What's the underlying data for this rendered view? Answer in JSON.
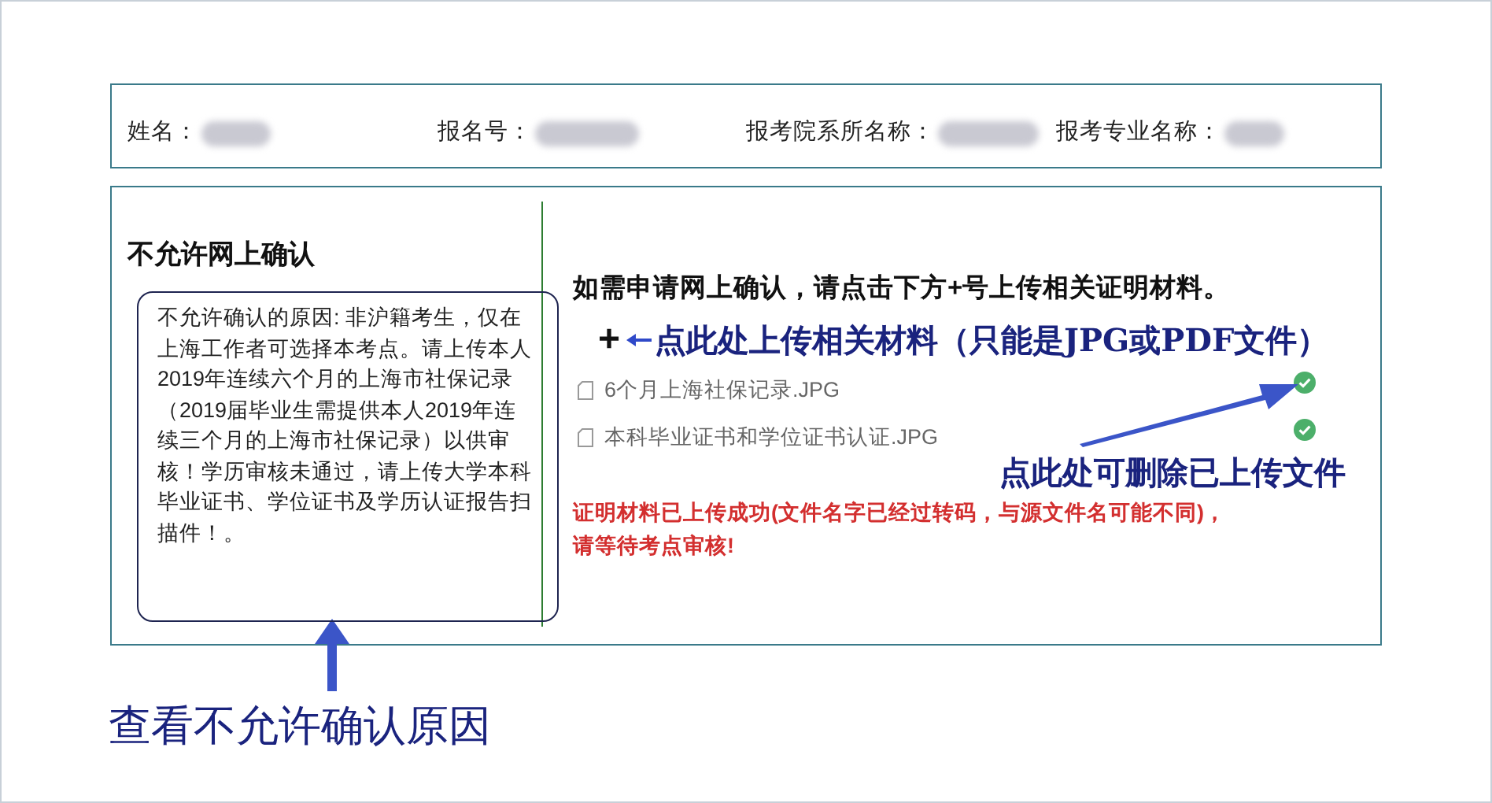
{
  "applicant_info": {
    "fields": [
      {
        "label": "姓名："
      },
      {
        "label": "报名号："
      },
      {
        "label": "报考院系所名称："
      },
      {
        "label": "报考专业名称："
      }
    ]
  },
  "left_panel": {
    "title": "不允许网上确认",
    "reason": "不允许确认的原因: 非沪籍考生，仅在上海工作者可选择本考点。请上传本人2019年连续六个月的上海市社保记录（2019届毕业生需提供本人2019年连续三个月的上海市社保记录）以供审核！学历审核未通过，请上传大学本科毕业证书、学位证书及学历认证报告扫描件！。"
  },
  "right_panel": {
    "heading": "如需申请网上确认，请点击下方+号上传相关证明材料。",
    "upload_button": "+",
    "upload_note": "点此处上传相关材料（只能是JPG或PDF文件）",
    "files": [
      {
        "name": "6个月上海社保记录.JPG"
      },
      {
        "name": "本科毕业证书和学位证书认证.JPG"
      }
    ],
    "delete_note": "点此处可删除已上传文件",
    "message": [
      "证明材料已上传成功(文件名字已经过转码，与源文件名可能不同)，",
      "请等待考点审核!"
    ]
  },
  "bottom_note": "查看不允许确认原因"
}
